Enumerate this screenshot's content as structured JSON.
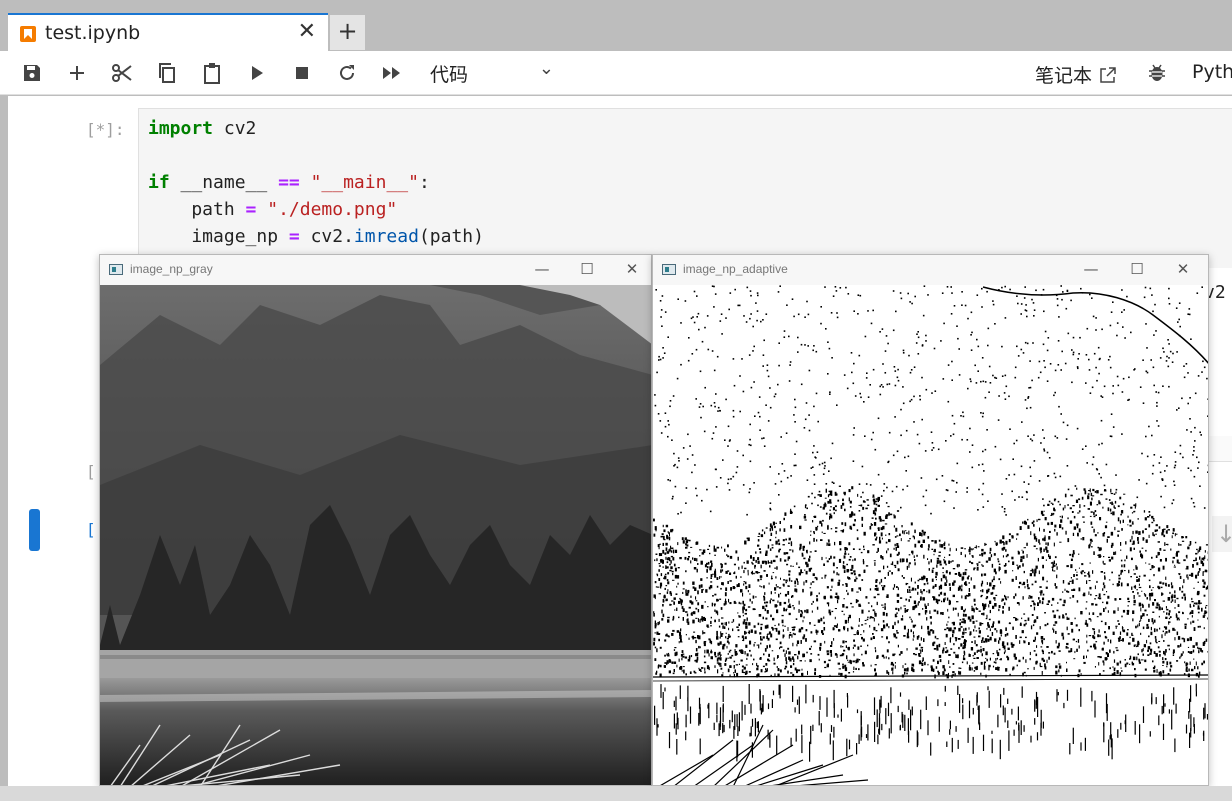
{
  "tab": {
    "title": "test.ipynb",
    "close": "✕",
    "new": "+"
  },
  "toolbar": {
    "save_icon": "save-icon",
    "add_icon": "plus-icon",
    "cut_icon": "scissors-icon",
    "copy_icon": "copy-icon",
    "paste_icon": "paste-icon",
    "run_icon": "play-icon",
    "stop_icon": "stop-icon",
    "restart_icon": "restart-icon",
    "run_all_icon": "fast-forward-icon",
    "cell_type": "代码",
    "notebook_label": "笔记本",
    "kernel": "Pyth"
  },
  "cells": {
    "prompt_1": "[*]:",
    "code": {
      "l1_kw": "import",
      "l1_rest": " cv2",
      "l3_kw": "if",
      "l3_name": " __name__ ",
      "l3_op": "==",
      "l3_str": " \"__main__\"",
      "l3_colon": ":",
      "l4_var": "    path ",
      "l4_op": "=",
      "l4_str": " \"./demo.png\"",
      "l5_var": "    image_np ",
      "l5_op": "=",
      "l5_pre": " cv2.",
      "l5_fn": "imread",
      "l5_arg": "(path)"
    },
    "peek": "v2",
    "prompt_2": "[",
    "prompt_3": "["
  },
  "windows": {
    "gray": {
      "title": "image_np_gray"
    },
    "adaptive": {
      "title": "image_np_adaptive"
    },
    "minimize": "—",
    "maximize": "☐",
    "close": "✕"
  },
  "colors": {
    "accent": "#1976d2",
    "tab_icon": "#f57c00",
    "keyword": "#008000",
    "operator": "#aa22ff",
    "string": "#ba2121"
  }
}
